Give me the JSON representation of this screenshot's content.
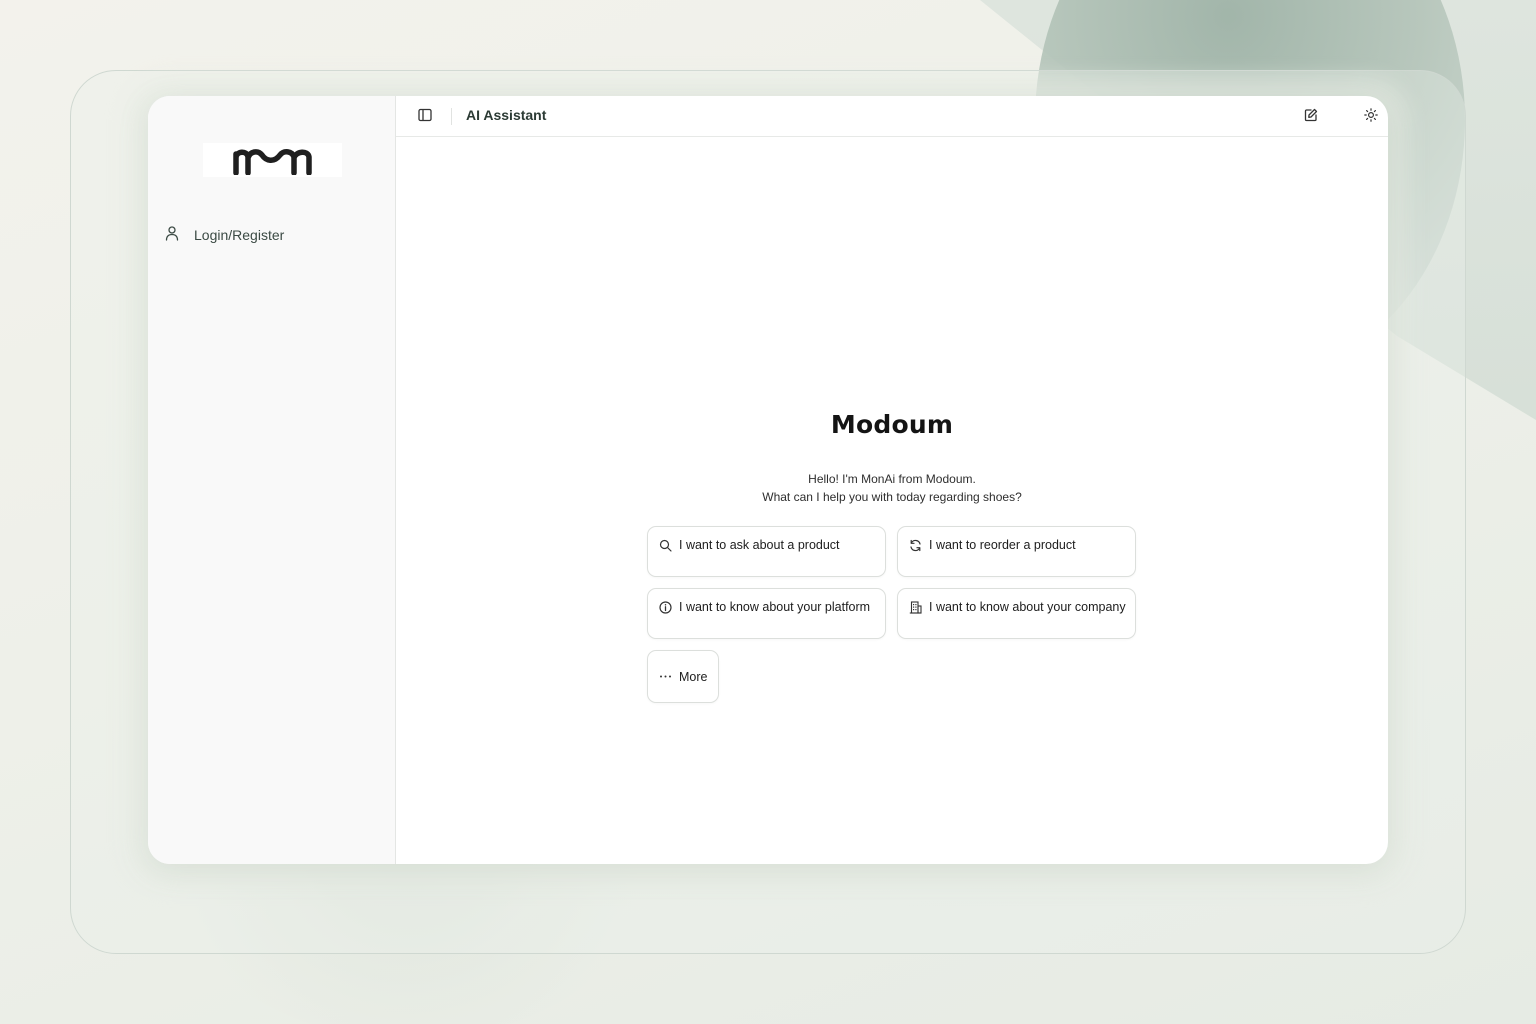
{
  "logo": {
    "alt": "mn"
  },
  "sidebar": {
    "items": [
      {
        "label": "Login/Register",
        "icon": "user-icon"
      }
    ]
  },
  "header": {
    "title": "AI Assistant",
    "left_icon": "sidebar-toggle-icon",
    "right_icons": [
      "edit-icon",
      "sun-icon"
    ]
  },
  "main": {
    "brand_title": "Modoum",
    "greeting_line1": "Hello! I'm MonAi from Modoum.",
    "greeting_line2": "What can I help you with today regarding shoes?",
    "suggestions": [
      {
        "label": "I want to ask about a product",
        "icon": "search-icon"
      },
      {
        "label": "I want to reorder a product",
        "icon": "refresh-icon"
      },
      {
        "label": "I want to know about your platform",
        "icon": "info-icon"
      },
      {
        "label": "I want to know about your company",
        "icon": "building-icon"
      },
      {
        "label": "More",
        "icon": "more-icon"
      }
    ]
  },
  "colors": {
    "app_background": "#ffffff",
    "sidebar_background": "#f9f9f9",
    "page_background": "#eef0e9",
    "accent_blob": "#9bb0a4",
    "text_primary": "#141414",
    "border": "#dcdfdc"
  }
}
